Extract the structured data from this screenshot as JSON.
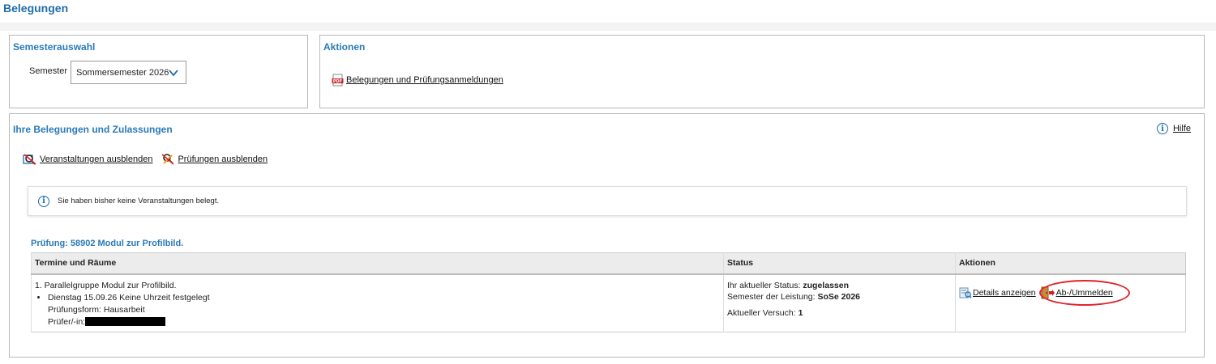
{
  "page": {
    "title": "Belegungen"
  },
  "semester_panel": {
    "title": "Semesterauswahl",
    "label": "Semester",
    "selected": "Sommersemester 2026"
  },
  "actions_panel": {
    "title": "Aktionen",
    "pdf_link": "Belegungen und Prüfungsanmeldungen"
  },
  "belegungen_panel": {
    "title": "Ihre Belegungen und Zulassungen",
    "help": "Hilfe",
    "toggle_courses": "Veranstaltungen ausblenden",
    "toggle_exams": "Prüfungen ausblenden",
    "notice": "Sie haben bisher keine Veranstaltungen belegt."
  },
  "exam": {
    "title": "Prüfung: 58902 Modul zur Profilbild.",
    "columns": [
      "Termine und Räume",
      "Status",
      "Aktionen"
    ],
    "group": "1. Parallelgruppe Modul zur Profilbild.",
    "date": "Dienstag 15.09.26 Keine Uhrzeit festgelegt",
    "form": "Prüfungsform: Hausarbeit",
    "examiner_label": "Prüfer/-in:",
    "status_label": "Ihr aktueller Status:",
    "status_value": "zugelassen",
    "semester_label": "Semester der Leistung:",
    "semester_value": "SoSe 2026",
    "attempt_label": "Aktueller Versuch:",
    "attempt_value": "1",
    "details_link": "Details anzeigen",
    "unregister_link": "Ab-/Ummelden"
  },
  "colors": {
    "accent": "#1f6ea8",
    "highlight": "#e0242b"
  }
}
